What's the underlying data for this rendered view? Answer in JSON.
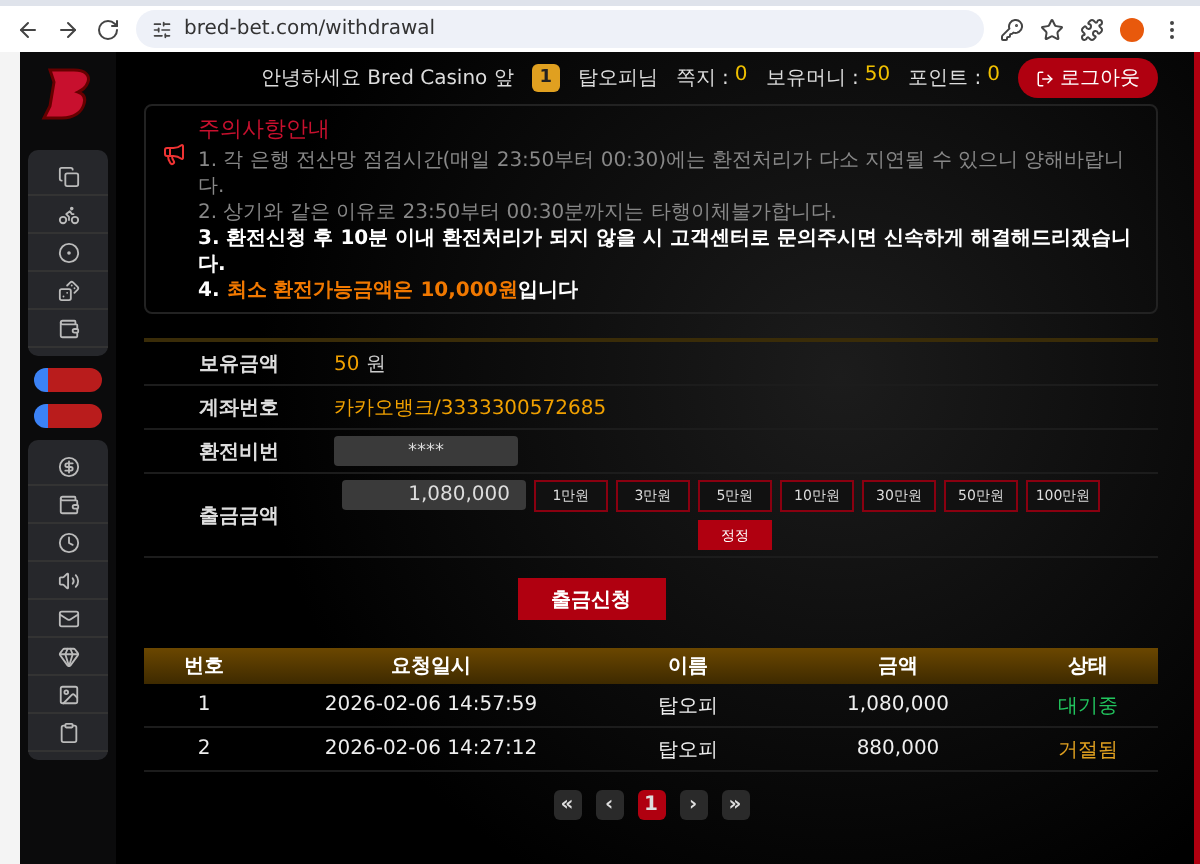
{
  "browser": {
    "url": "bred-bet.com/withdrawal"
  },
  "header": {
    "greeting": "안녕하세요 Bred Casino 앞",
    "level": "1",
    "user": "탑오피님",
    "stats": [
      {
        "label": "쪽지 :",
        "value": "0"
      },
      {
        "label": "보유머니 :",
        "value": "50"
      },
      {
        "label": "포인트 :",
        "value": "0"
      }
    ],
    "logout": "로그아웃"
  },
  "notice": {
    "title": "주의사항안내",
    "lines": [
      {
        "kind": "muted",
        "text": "1. 각 은행 전산망 점검시간(매일 23:50부터 00:30)에는 환전처리가 다소 지연될 수 있으니 양해바랍니다."
      },
      {
        "kind": "muted",
        "text": "2. 상기와 같은 이유로 23:50부터 00:30분까지는 타행이체불가합니다."
      },
      {
        "kind": "bold",
        "text": "3. 환전신청 후 10분 이내 환전처리가 되지 않을 시 고객센터로 문의주시면 신속하게 해결해드리겠습니다."
      },
      {
        "kind": "highlight",
        "prefix": "4.",
        "highlight": "최소 환전가능금액은 10,000원",
        "rest": "입니다"
      }
    ]
  },
  "form": {
    "balance": {
      "label": "보유금액",
      "value": "50",
      "unit": "원"
    },
    "account": {
      "label": "계좌번호",
      "value": "카카오뱅크/3333300572685"
    },
    "password": {
      "label": "환전비번",
      "value": "****"
    },
    "amount": {
      "label": "출금금액",
      "value": "1,080,000",
      "presets": [
        "1만원",
        "3만원",
        "5만원",
        "10만원",
        "30만원",
        "50만원",
        "100만원"
      ],
      "reset": "정정"
    },
    "submit": "출금신청"
  },
  "table": {
    "columns": [
      "번호",
      "요청일시",
      "이름",
      "금액",
      "상태"
    ],
    "rows": [
      {
        "no": "1",
        "date": "2026-02-06 14:57:59",
        "name": "탑오피",
        "amount": "1,080,000",
        "status": "대기중",
        "color": "#22c55e"
      },
      {
        "no": "2",
        "date": "2026-02-06 14:27:12",
        "name": "탑오피",
        "amount": "880,000",
        "status": "거절됨",
        "color": "#e0a020"
      }
    ]
  },
  "pagination": {
    "first": "«",
    "prev": "‹",
    "pages": [
      {
        "label": "1",
        "selected": true
      }
    ],
    "next": "›",
    "last": "»"
  }
}
